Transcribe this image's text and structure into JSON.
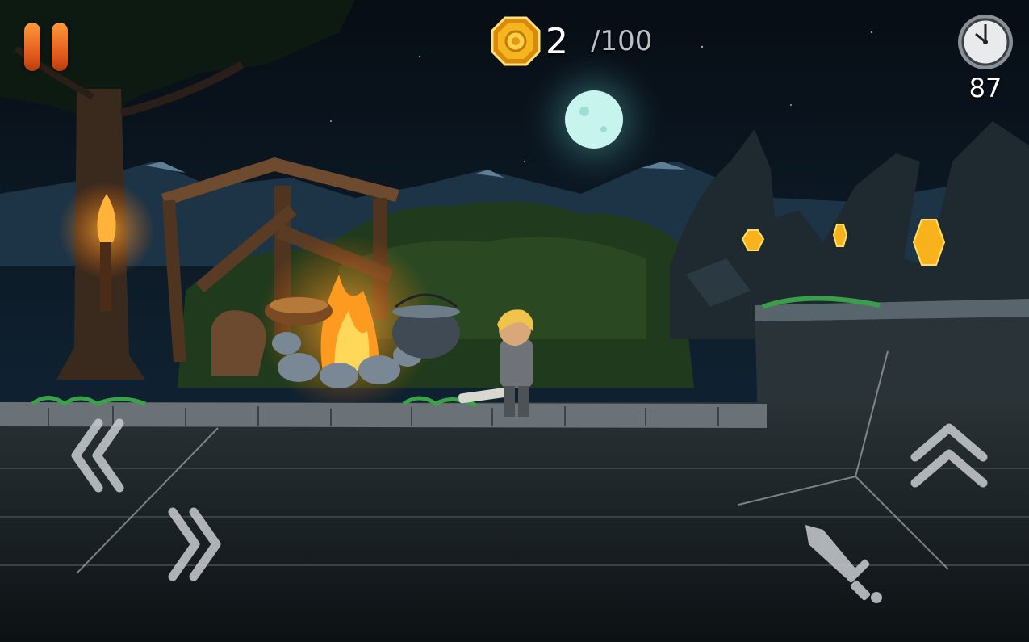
{
  "hud": {
    "pause_icon": "pause-icon",
    "coins": {
      "icon": "gold-coin-icon",
      "collected": "2",
      "total": "/100"
    },
    "timer": {
      "icon": "clock-icon",
      "value": "87"
    }
  },
  "controls": {
    "move_left": {
      "icon": "double-chevron-left-icon"
    },
    "move_right": {
      "icon": "double-chevron-right-icon"
    },
    "jump": {
      "icon": "double-chevron-up-icon"
    },
    "attack": {
      "icon": "sword-icon"
    }
  },
  "colors": {
    "accent_orange": "#f07a2a",
    "coin_gold": "#f2b21c",
    "sky": "#0d1c28",
    "moon": "#bff0ea"
  }
}
